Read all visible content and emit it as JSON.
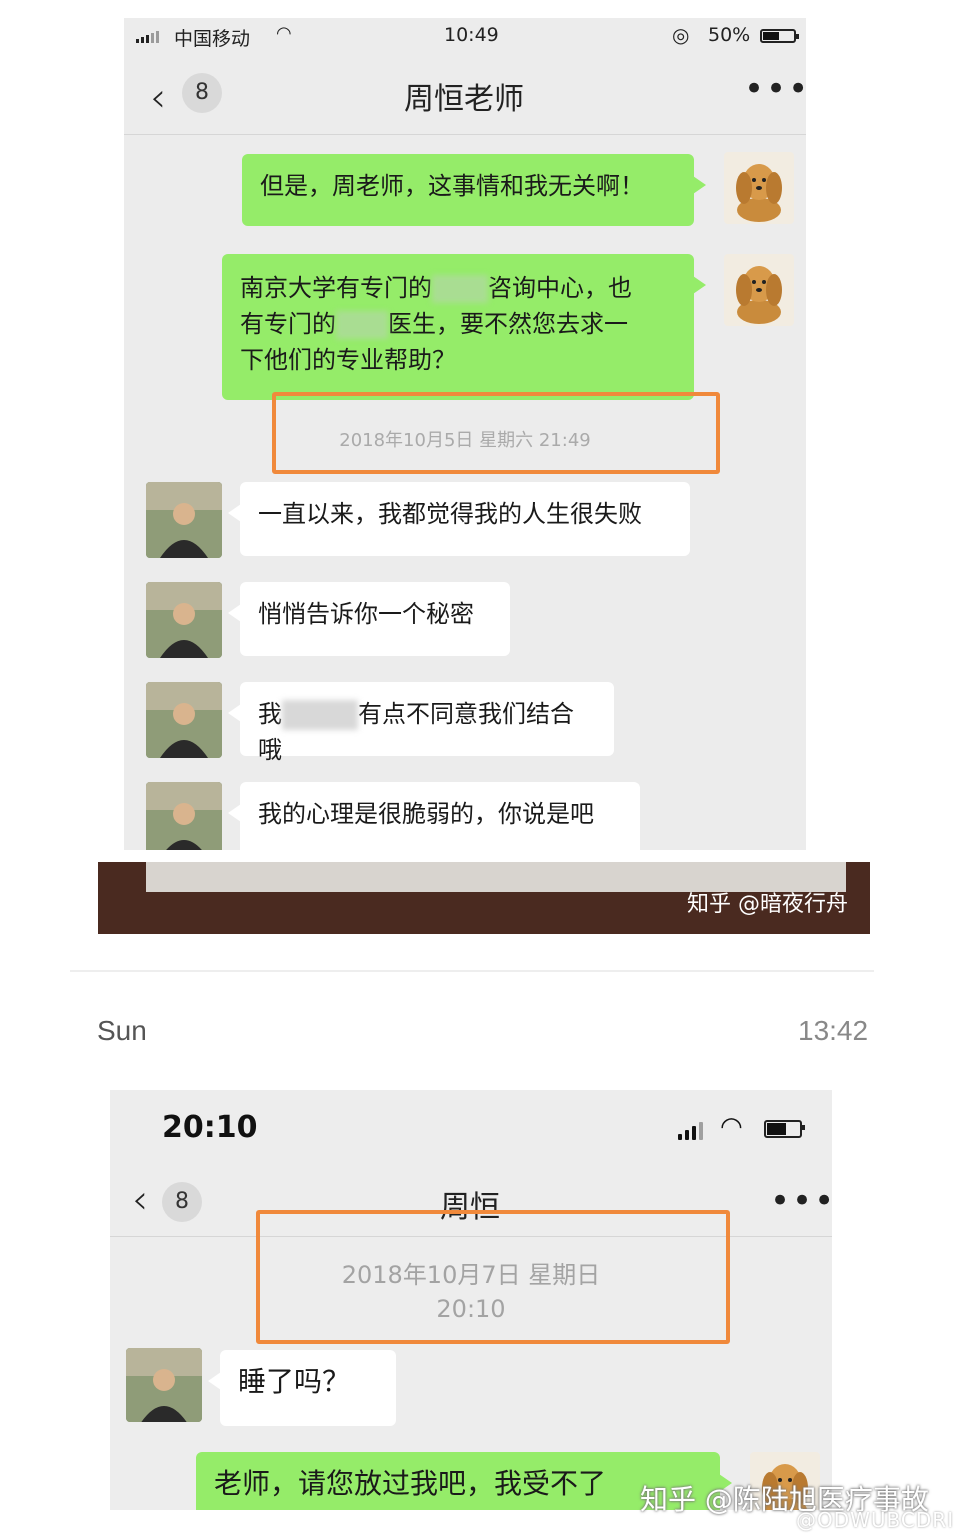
{
  "top_screenshot": {
    "status": {
      "carrier": "中国移动",
      "time": "10:49",
      "battery": "50%",
      "battery_level": 0.5
    },
    "nav": {
      "back_count": "8",
      "title": "周恒老师",
      "more": "•••"
    },
    "messages": [
      {
        "side": "right",
        "avatar": "dog-avatar",
        "text": "但是，周老师，这事情和我无关啊！"
      },
      {
        "side": "right",
        "avatar": "dog-avatar",
        "lines": [
          "南京大学有专门的",
          "咨询中心，也",
          "有专门的",
          "医生，要不然您去求一",
          "下他们的专业帮助？"
        ]
      },
      {
        "type": "timestamp",
        "text": "2018年10月5日 星期六 21:49"
      },
      {
        "side": "left",
        "avatar": "man-avatar",
        "text": "一直以来，我都觉得我的人生很失败"
      },
      {
        "side": "left",
        "avatar": "man-avatar",
        "text": "悄悄告诉你一个秘密"
      },
      {
        "side": "left",
        "avatar": "man-avatar",
        "prefix": "我",
        "text": "有点不同意我们结合哦"
      },
      {
        "side": "left",
        "avatar": "man-avatar",
        "text": "我的心理是很脆弱的，你说是吧"
      }
    ]
  },
  "middle": {
    "watermark": "知乎 @暗夜行舟",
    "day": "Sun",
    "time": "13:42"
  },
  "bottom_screenshot": {
    "status": {
      "time": "20:10",
      "battery_level": 0.55
    },
    "nav": {
      "back_count": "8",
      "title": "周恒",
      "more": "•••"
    },
    "timestamp": {
      "date": "2018年10月7日 星期日",
      "time": "20:10"
    },
    "messages": [
      {
        "side": "left",
        "avatar": "man-avatar",
        "text": "睡了吗？"
      },
      {
        "side": "right",
        "avatar": "dog-avatar",
        "text": "老师，请您放过我吧，我受不了"
      }
    ]
  },
  "watermarks": {
    "zhihu": "知乎 @陈陆旭医疗事故",
    "weibo": "@ODWUBCDRI"
  },
  "colors": {
    "highlight": "#f0893b",
    "bubble_green": "#95ec69",
    "bubble_white": "#ffffff"
  }
}
